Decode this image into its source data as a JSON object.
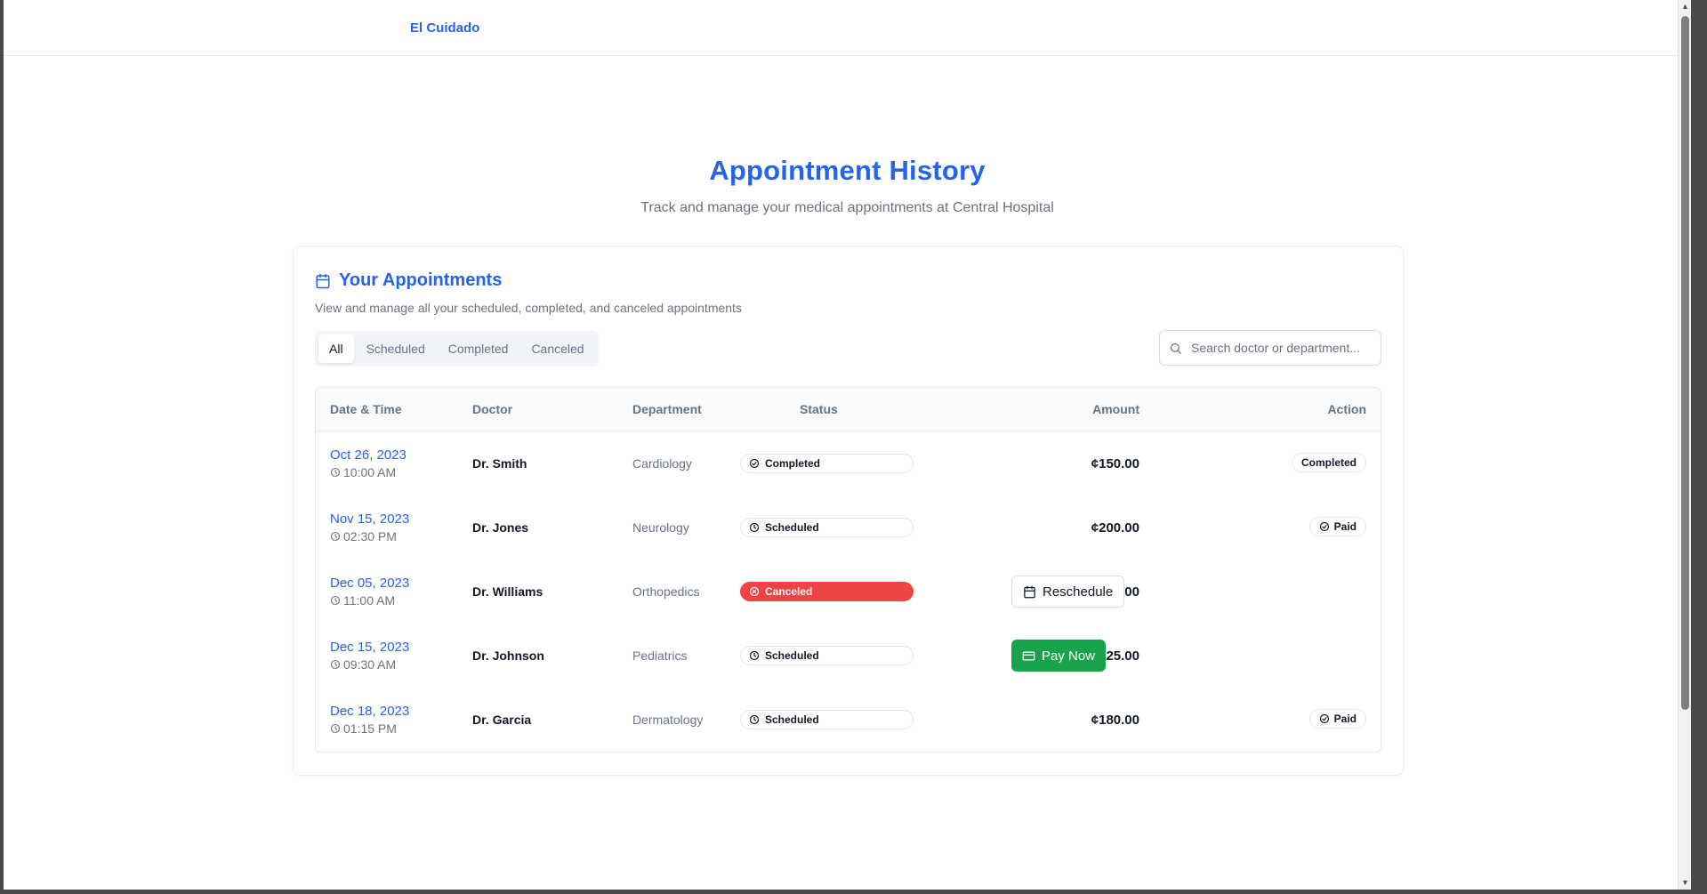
{
  "brand": "El Cuidado",
  "page": {
    "title": "Appointment History",
    "subtitle": "Track and manage your medical appointments at Central Hospital"
  },
  "card": {
    "title": "Your Appointments",
    "description": "View and manage all your scheduled, completed, and canceled appointments",
    "tabs": [
      "All",
      "Scheduled",
      "Completed",
      "Canceled"
    ],
    "active_tab": "All",
    "search_placeholder": "Search doctor or department..."
  },
  "table": {
    "headers": {
      "date": "Date & Time",
      "doctor": "Doctor",
      "department": "Department",
      "status": "Status",
      "amount": "Amount",
      "action": "Action"
    },
    "rows": [
      {
        "date": "Oct 26, 2023",
        "time": "10:00 AM",
        "doctor": "Dr. Smith",
        "department": "Cardiology",
        "status": "Completed",
        "amount": "¢150.00",
        "action": "Completed"
      },
      {
        "date": "Nov 15, 2023",
        "time": "02:30 PM",
        "doctor": "Dr. Jones",
        "department": "Neurology",
        "status": "Scheduled",
        "amount": "¢200.00",
        "action": "Paid"
      },
      {
        "date": "Dec 05, 2023",
        "time": "11:00 AM",
        "doctor": "Dr. Williams",
        "department": "Orthopedics",
        "status": "Canceled",
        "amount": "¢175.00",
        "action": "Reschedule"
      },
      {
        "date": "Dec 15, 2023",
        "time": "09:30 AM",
        "doctor": "Dr. Johnson",
        "department": "Pediatrics",
        "status": "Scheduled",
        "amount": "¢225.00",
        "action": "Pay Now"
      },
      {
        "date": "Dec 18, 2023",
        "time": "01:15 PM",
        "doctor": "Dr. Garcia",
        "department": "Dermatology",
        "status": "Scheduled",
        "amount": "¢180.00",
        "action": "Paid"
      }
    ]
  },
  "colors": {
    "accent": "#2563eb",
    "canceled": "#ef4444",
    "pay": "#16a34a"
  }
}
